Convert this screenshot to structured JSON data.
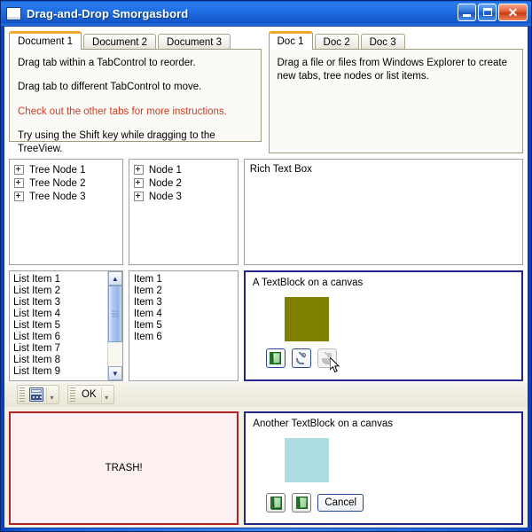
{
  "window": {
    "title": "Drag-and-Drop Smorgasbord",
    "icon": "window-icon",
    "minimize_label": "Minimize",
    "maximize_label": "Maximize",
    "close_label": "✕",
    "frame_color": "#0a3a9c",
    "client_background": "#f2f1e4"
  },
  "left_tabcontrol": {
    "tabs": [
      {
        "label": "Document 1",
        "selected": true
      },
      {
        "label": "Document 2",
        "selected": false
      },
      {
        "label": "Document 3",
        "selected": false
      }
    ],
    "instructions": [
      {
        "text": "Drag tab within a TabControl to reorder.",
        "color": "#000000"
      },
      {
        "text": "Drag tab to different TabControl to move.",
        "color": "#000000"
      },
      {
        "text": "Check out the other tabs for more instructions.",
        "color": "#d23a20"
      },
      {
        "text": "Try using the Shift key while dragging to the TreeView.",
        "color": "#000000"
      }
    ]
  },
  "right_tabcontrol": {
    "tabs": [
      {
        "label": "Doc 1",
        "selected": true
      },
      {
        "label": "Doc 2",
        "selected": false
      },
      {
        "label": "Doc 3",
        "selected": false
      }
    ],
    "body_text": "Drag a file or files from Windows Explorer to create new tabs, tree nodes or list items."
  },
  "treeview_1": {
    "nodes": [
      "Tree Node 1",
      "Tree Node 2",
      "Tree Node 3"
    ]
  },
  "treeview_2": {
    "nodes": [
      "Node 1",
      "Node 2",
      "Node 3"
    ]
  },
  "richtextbox": {
    "text": "Rich Text Box"
  },
  "listbox_1": {
    "items": [
      "List Item 1",
      "List Item 2",
      "List Item 3",
      "List Item 4",
      "List Item 5",
      "List Item 6",
      "List Item 7",
      "List Item 8",
      "List Item 9"
    ],
    "scrollbar": {
      "up_arrow": "▲",
      "down_arrow": "▼"
    }
  },
  "listbox_2": {
    "items": [
      "Item 1",
      "Item 2",
      "Item 3",
      "Item 4",
      "Item 5",
      "Item 6"
    ]
  },
  "canvas_top": {
    "label": "A TextBlock on a canvas",
    "square_color": "#808000",
    "buttons": [
      {
        "name": "book-button",
        "icon": "book-icon",
        "enabled": true
      },
      {
        "name": "pen-button",
        "icon": "pen-icon",
        "enabled": true
      },
      {
        "name": "pen-disabled-button",
        "icon": "pen-icon",
        "enabled": false
      }
    ],
    "border_color": "#24248f"
  },
  "canvas_bottom": {
    "label": "Another TextBlock on a canvas",
    "square_color": "#addce3",
    "buttons": [
      {
        "name": "book-stack-button",
        "icon": "book-stack-icon",
        "label": ""
      },
      {
        "name": "book-button",
        "icon": "book-icon",
        "label": ""
      },
      {
        "name": "cancel-button",
        "icon": "",
        "label": "Cancel"
      }
    ],
    "border_color": "#24248f"
  },
  "toolbar": {
    "groups": [
      {
        "name": "calculator-group",
        "icon": "calculator-icon",
        "label": "",
        "overflow": "▾"
      },
      {
        "name": "ok-group",
        "icon": "",
        "label": "OK",
        "overflow": "▾"
      }
    ]
  },
  "trash": {
    "label": "TRASH!",
    "border_color": "#b32222",
    "background_color": "#fdf0f0"
  }
}
